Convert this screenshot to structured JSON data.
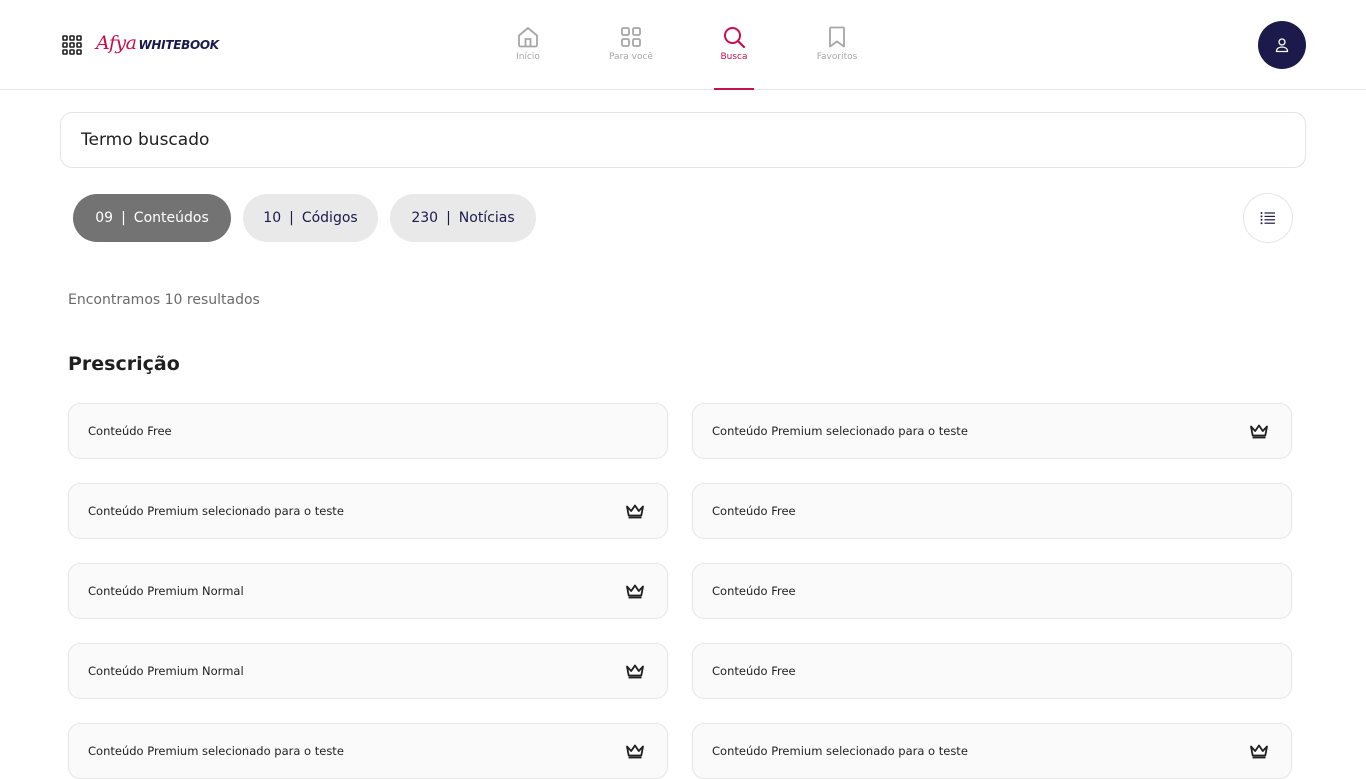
{
  "brand": {
    "afya": "Afya",
    "whitebook": "WHITEBOOK"
  },
  "nav": [
    {
      "label": "Início",
      "icon": "home-icon",
      "active": false
    },
    {
      "label": "Para você",
      "icon": "grid-icon",
      "active": false
    },
    {
      "label": "Busca",
      "icon": "search-icon",
      "active": true
    },
    {
      "label": "Favoritos",
      "icon": "bookmark-icon",
      "active": false
    }
  ],
  "search": {
    "value": "Termo buscado",
    "placeholder": "Termo buscado"
  },
  "filters": [
    {
      "count": "09",
      "label": "Conteúdos",
      "active": true
    },
    {
      "count": "10",
      "label": "Códigos",
      "active": false
    },
    {
      "count": "230",
      "label": "Notícias",
      "active": false
    }
  ],
  "results_text": "Encontramos 10 resultados",
  "section_title": "Prescrição",
  "cards": [
    {
      "label": "Conteúdo Free",
      "premium": false
    },
    {
      "label": "Conteúdo Premium selecionado para o teste",
      "premium": true
    },
    {
      "label": "Conteúdo Premium selecionado para o teste",
      "premium": true
    },
    {
      "label": "Conteúdo Free",
      "premium": false
    },
    {
      "label": "Conteúdo Premium Normal",
      "premium": true
    },
    {
      "label": "Conteúdo Free",
      "premium": false
    },
    {
      "label": "Conteúdo Premium Normal",
      "premium": true
    },
    {
      "label": "Conteúdo Free",
      "premium": false
    },
    {
      "label": "Conteúdo Premium selecionado para o teste",
      "premium": true
    },
    {
      "label": "Conteúdo Premium selecionado para o teste",
      "premium": true
    }
  ],
  "colors": {
    "accent": "#c8104f",
    "navy": "#1b1a4b",
    "chip_active": "#737373",
    "chip": "#e9e9e9"
  }
}
